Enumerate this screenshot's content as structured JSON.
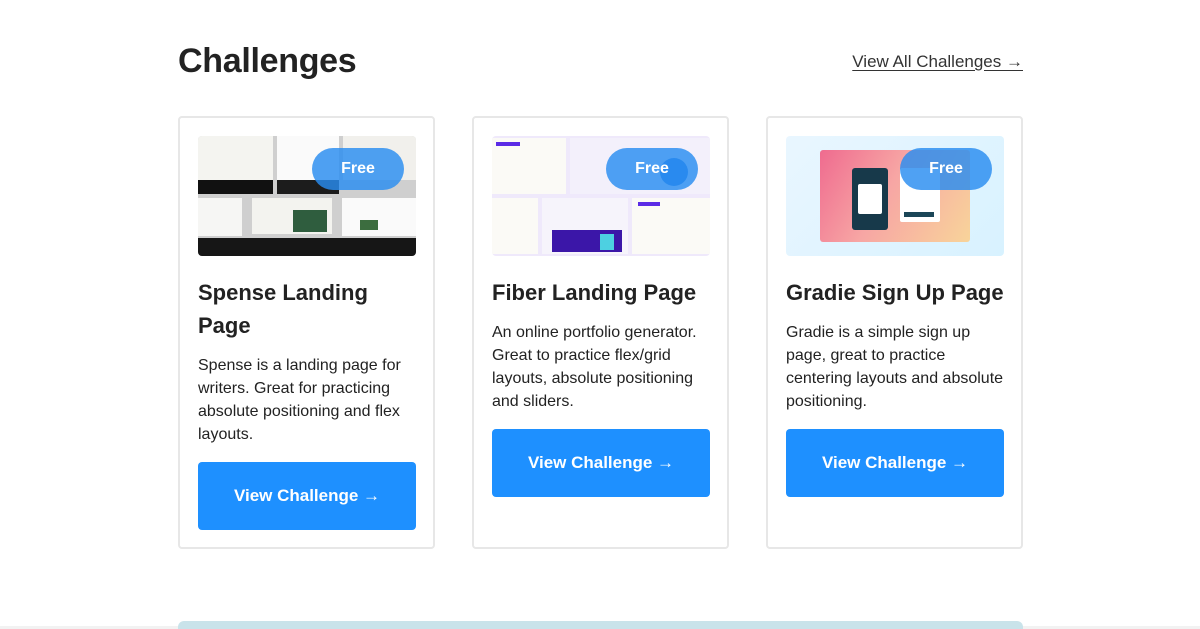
{
  "header": {
    "title": "Challenges",
    "view_all": "View All Challenges →"
  },
  "cards": [
    {
      "badge": "Free",
      "title": "Spense Landing Page",
      "description": "Spense is a landing page for writers. Great for practicing absolute positioning and flex layouts.",
      "button": "View Challenge →"
    },
    {
      "badge": "Free",
      "title": "Fiber Landing Page",
      "description": "An online portfolio generator. Great to practice flex/grid layouts, absolute positioning and sliders.",
      "button": "View Challenge →"
    },
    {
      "badge": "Free",
      "title": "Gradie Sign Up Page",
      "description": "Gradie is a simple sign up page, great to practice centering layouts and absolute positioning.",
      "button": "View Challenge →"
    }
  ],
  "colors": {
    "accent": "#1e90ff",
    "badge": "#288cf0",
    "card_border": "#e7e7e7"
  }
}
